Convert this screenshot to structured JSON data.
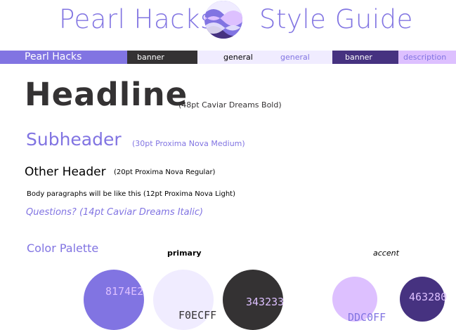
{
  "header": {
    "title_left": "Pearl Hacks",
    "title_right": "Style Guide",
    "logo_icon": "pearl-wave-logo-icon"
  },
  "swatch_bar": {
    "segments": [
      {
        "label": "Pearl Hacks",
        "color": "#8174e2",
        "text_color": "#ffffff"
      },
      {
        "label": "banner",
        "color": "#343233",
        "text_color": "#ffffff"
      },
      {
        "label": "general",
        "color": "#f0ecff",
        "text_color": "#000000"
      },
      {
        "label": "general",
        "color": "#f0ecff",
        "text_color": "#8174e2"
      },
      {
        "label": "banner",
        "color": "#463280",
        "text_color": "#ffffff"
      },
      {
        "label": "description",
        "color": "#ddc0ff",
        "text_color": "#8174e2"
      }
    ]
  },
  "typography": {
    "headline": "Headline",
    "headline_note": "(48pt Caviar Dreams Bold)",
    "subheader": "Subheader",
    "subheader_note": "(30pt Proxima Nova Medium)",
    "other_header": "Other Header",
    "other_header_note": "(20pt Proxima Nova Regular)",
    "body": "Body paragraphs will be like this (12pt Proxima Nova Light)",
    "questions": "Questions? (14pt Caviar Dreams Italic)"
  },
  "palette": {
    "title": "Color Palette",
    "primary_label": "primary",
    "accent_label": "accent",
    "colors": [
      {
        "hex": "8174E2",
        "color": "#8174e2",
        "text_color": "#ddc0ff"
      },
      {
        "hex": "F0ECFF",
        "color": "#f0ecff",
        "text_color": "#343233"
      },
      {
        "hex": "343233",
        "color": "#343233",
        "text_color": "#ddc0ff"
      },
      {
        "hex": "DDC0FF",
        "color": "#ddc0ff",
        "text_color": "#8174e2"
      },
      {
        "hex": "463280",
        "color": "#463280",
        "text_color": "#ddc0ff"
      }
    ]
  }
}
